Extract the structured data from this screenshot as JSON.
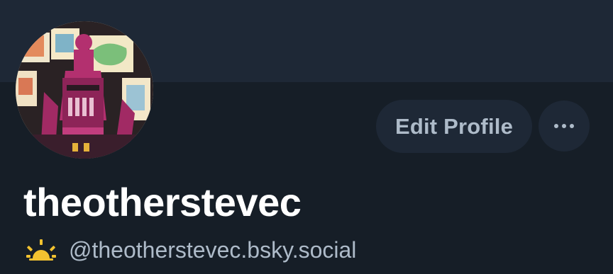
{
  "profile": {
    "display_name": "theotherstevec",
    "handle": "@theotherstevec.bsky.social",
    "handle_icon": "sun-icon",
    "avatar_icon": "avatar-image"
  },
  "actions": {
    "edit_profile_label": "Edit Profile",
    "more_icon": "ellipsis-icon"
  },
  "colors": {
    "background": "#161e27",
    "banner": "#1e2836",
    "button_bg": "#1e2836",
    "button_text": "#aebbc9",
    "display_name": "#ffffff",
    "handle_text": "#aebbc9",
    "sun_icon": "#f2c230"
  }
}
